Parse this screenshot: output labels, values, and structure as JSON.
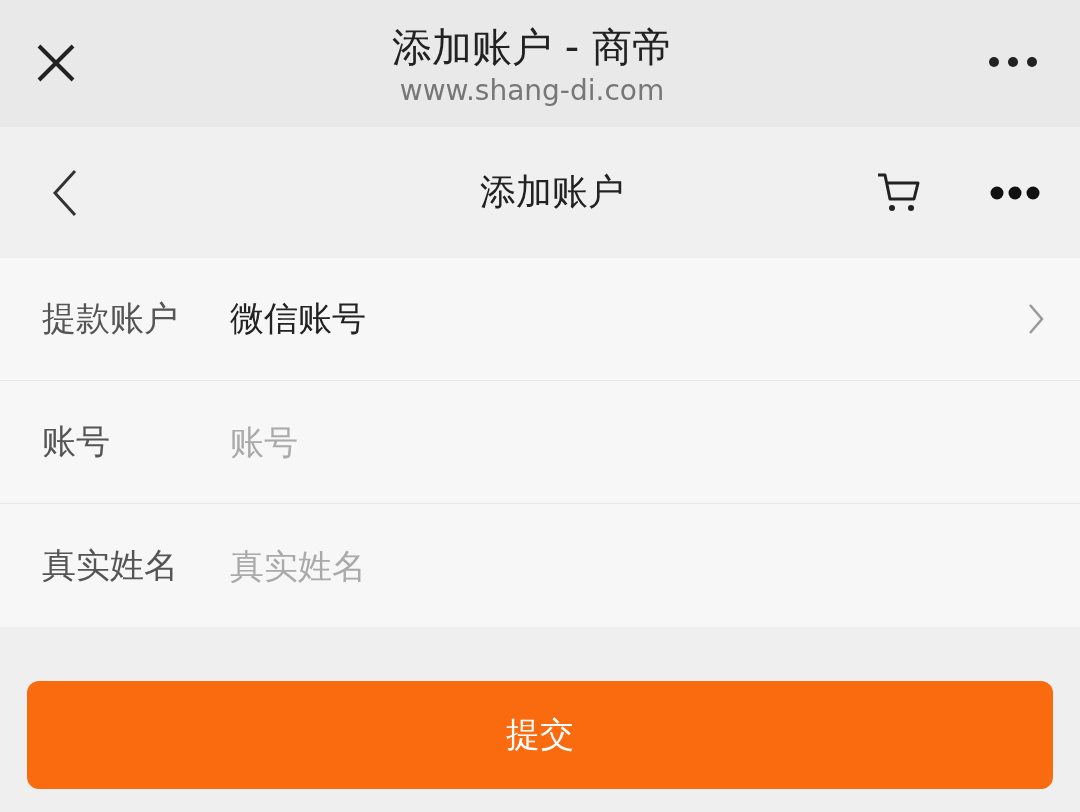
{
  "browser_bar": {
    "title": "添加账户 - 商帝",
    "url": "www.shang-di.com"
  },
  "nav_bar": {
    "title": "添加账户"
  },
  "form": {
    "rows": [
      {
        "kind": "select",
        "label": "提款账户",
        "value": "微信账号"
      },
      {
        "kind": "input",
        "label": "账号",
        "placeholder": "账号"
      },
      {
        "kind": "input",
        "label": "真实姓名",
        "placeholder": "真实姓名"
      }
    ]
  },
  "submit_button": {
    "label": "提交"
  }
}
